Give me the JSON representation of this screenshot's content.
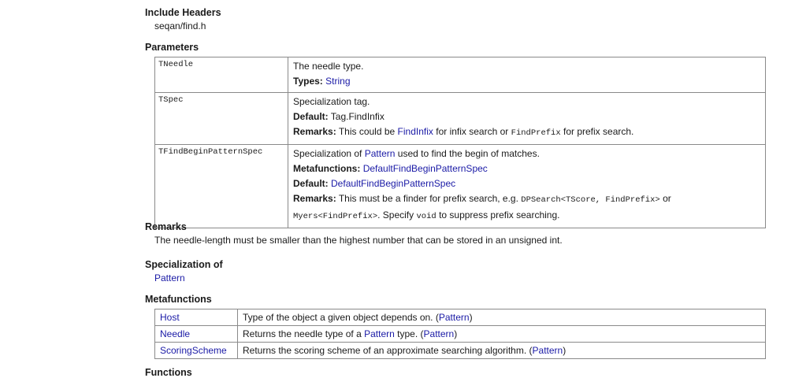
{
  "include": {
    "heading": "Include Headers",
    "value": "seqan/find.h"
  },
  "params": {
    "heading": "Parameters",
    "rows": [
      {
        "name": "TNeedle",
        "desc": "The needle type.",
        "types_label": "Types:",
        "types_value": "String"
      },
      {
        "name": "TSpec",
        "desc": "Specialization tag.",
        "default_label": "Default:",
        "default_value": "Tag.FindInfix",
        "remarks_label": "Remarks:",
        "remarks_pre": "This could be",
        "remarks_link": "FindInfix",
        "remarks_mid": "for infix search or",
        "remarks_code": "FindPrefix",
        "remarks_post": "for prefix search."
      },
      {
        "name": "TFindBeginPatternSpec",
        "desc_pre": "Specialization of",
        "desc_link": "Pattern",
        "desc_post": "used to find the begin of matches.",
        "meta_label": "Metafunctions:",
        "meta_value": "DefaultFindBeginPatternSpec",
        "default_label": "Default:",
        "default_value": "DefaultFindBeginPatternSpec",
        "remarks_label": "Remarks:",
        "remarks_pre": "This must be a finder for prefix search, e.g.",
        "remarks_code1": "DPSearch<TScore, FindPrefix>",
        "remarks_or": "or",
        "remarks_code2": "Myers<FindPrefix>",
        "remarks_mid": ". Specify",
        "remarks_code3": "void",
        "remarks_post": "to suppress prefix searching."
      }
    ]
  },
  "remarks": {
    "heading": "Remarks",
    "text": "The needle-length must be smaller than the highest number that can be stored in an unsigned int."
  },
  "specialization": {
    "heading": "Specialization of",
    "link": "Pattern"
  },
  "metafunctions": {
    "heading": "Metafunctions",
    "rows": [
      {
        "name": "Host",
        "desc": "Type of the object a given object depends on.",
        "ref": "Pattern"
      },
      {
        "name": "Needle",
        "desc_pre": "Returns the needle type of a",
        "desc_link": "Pattern",
        "desc_post": "type.",
        "ref": "Pattern"
      },
      {
        "name": "ScoringScheme",
        "desc": "Returns the scoring scheme of an approximate searching algorithm.",
        "ref": "Pattern"
      }
    ]
  },
  "functions": {
    "heading": "Functions"
  }
}
